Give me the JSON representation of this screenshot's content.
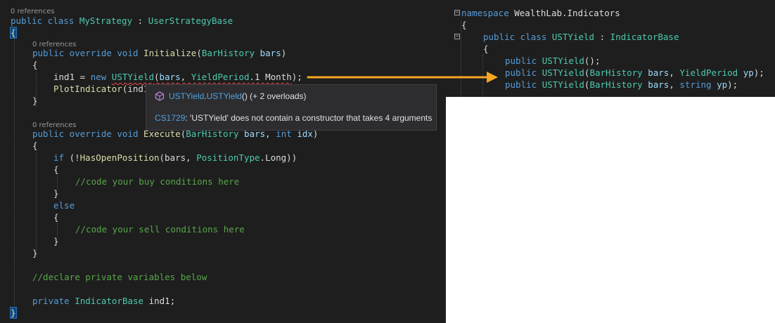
{
  "left_code": {
    "codelens1": "0 references",
    "class_decl": {
      "kw": "public class ",
      "name": "MyStrategy",
      "sep": " : ",
      "base": "UserStrategyBase"
    },
    "open_brace": "{",
    "codelens2": "0 references",
    "init_decl": {
      "kw": "public override void ",
      "name": "Initialize",
      "paren_open": "(",
      "ptype": "BarHistory",
      "pname": " bars",
      "paren_close": ")"
    },
    "init_open": "{",
    "ind1_line": {
      "lhs": "ind1 = ",
      "kw_new": "new ",
      "ctor": "USTYield",
      "open": "(",
      "arg1": "bars",
      "comma": ", ",
      "enum_type": "YieldPeriod",
      "enum_val": ".1 Month",
      "close": ");"
    },
    "plot_line": {
      "fn": "PlotIndicator",
      "rest": "(ind1"
    },
    "init_close": "}",
    "codelens3": "0 references",
    "exec_decl": {
      "kw": "public override void ",
      "name": "Execute",
      "p_open": "(",
      "ptype": "BarHistory",
      "pname": " bars",
      "comma": ", ",
      "kw_int": "int",
      "pidx": " idx",
      "p_close": ")"
    },
    "exec_open": "{",
    "if_line": {
      "kw": "if",
      "paren": " (!",
      "fn": "HasOpenPosition",
      "args_open": "(bars, ",
      "enum_type": "PositionType",
      "dot": ".",
      "enum_val": "Long",
      "close": "))"
    },
    "if_open": "{",
    "buy_comment": "//code your buy conditions here",
    "if_close": "}",
    "else_kw": "else",
    "else_open": "{",
    "sell_comment": "//code your sell conditions here",
    "else_close": "}",
    "exec_close": "}",
    "decl_comment": "//declare private variables below",
    "private_line": {
      "kw": "private ",
      "type": "IndicatorBase",
      "name": " ind1;"
    },
    "close_brace": "}"
  },
  "right_code": {
    "ns_line": {
      "kw": "namespace",
      "name": " WealthLab.Indicators"
    },
    "ns_open": "{",
    "class_line": {
      "kw": "public class ",
      "name": "USTYield",
      "sep": " : ",
      "base": "IndicatorBase"
    },
    "class_open": "{",
    "ctor1": {
      "kw": "public ",
      "name": "USTYield",
      "rest": "();"
    },
    "ctor2": {
      "kw": "public ",
      "name": "USTYield",
      "open": "(",
      "t1": "BarHistory",
      "p1": " bars",
      "comma": ", ",
      "t2": "YieldPeriod",
      "p2": " yp",
      "close": ");"
    },
    "ctor3": {
      "kw": "public ",
      "name": "USTYield",
      "open": "(",
      "t1": "BarHistory",
      "p1": " bars",
      "comma": ", ",
      "t2": "string",
      "p2": " yp",
      "close": ");"
    }
  },
  "tooltip": {
    "signature_class": "USTYield",
    "signature_dot": ".",
    "signature_method": "USTYield",
    "signature_rest": "() (+ 2 overloads)",
    "error_code": "CS1729",
    "error_message": ": 'USTYield' does not contain a constructor that takes 4 arguments"
  },
  "colors": {
    "editor_bg": "#1e1e1e",
    "keyword": "#569cd6",
    "type": "#4ec9b0",
    "method": "#dcdcaa",
    "parameter": "#9cdcfe",
    "comment": "#57a64a",
    "arrow": "#f5a623",
    "error_squiggle": "#f14c4c"
  }
}
